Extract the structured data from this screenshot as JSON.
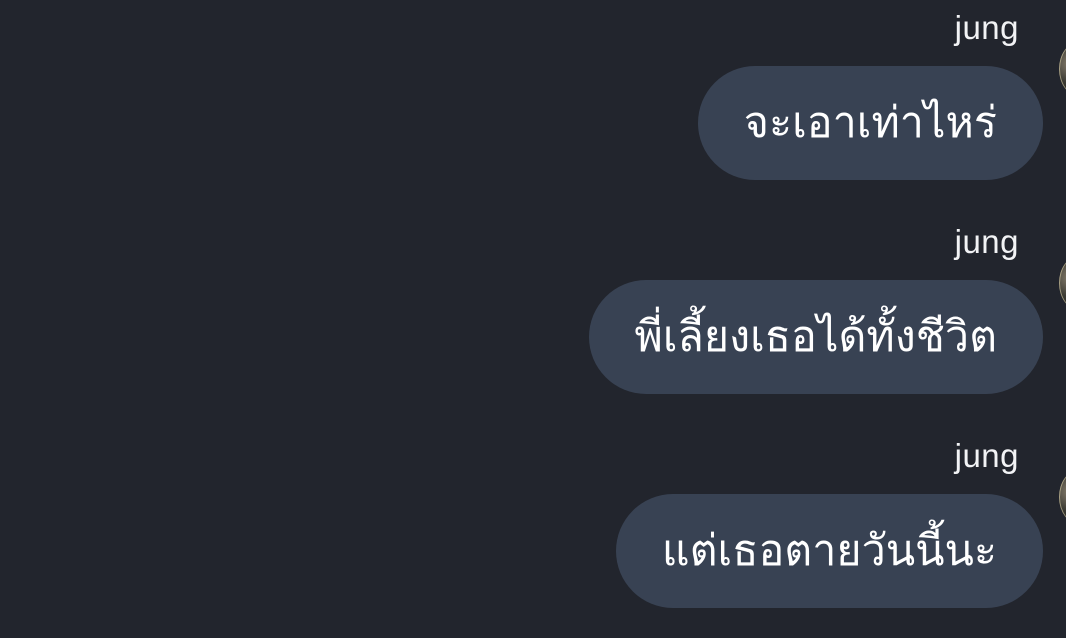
{
  "messages": [
    {
      "sender": "jung",
      "text": "จะเอาเท่าไหร่"
    },
    {
      "sender": "jung",
      "text": "พี่เลี้ยงเธอได้ทั้งชีวิต"
    },
    {
      "sender": "jung",
      "text": "แต่เธอตายวันนี้นะ"
    }
  ],
  "colors": {
    "background": "#22252d",
    "bubble": "#384253",
    "text": "#ffffff"
  }
}
